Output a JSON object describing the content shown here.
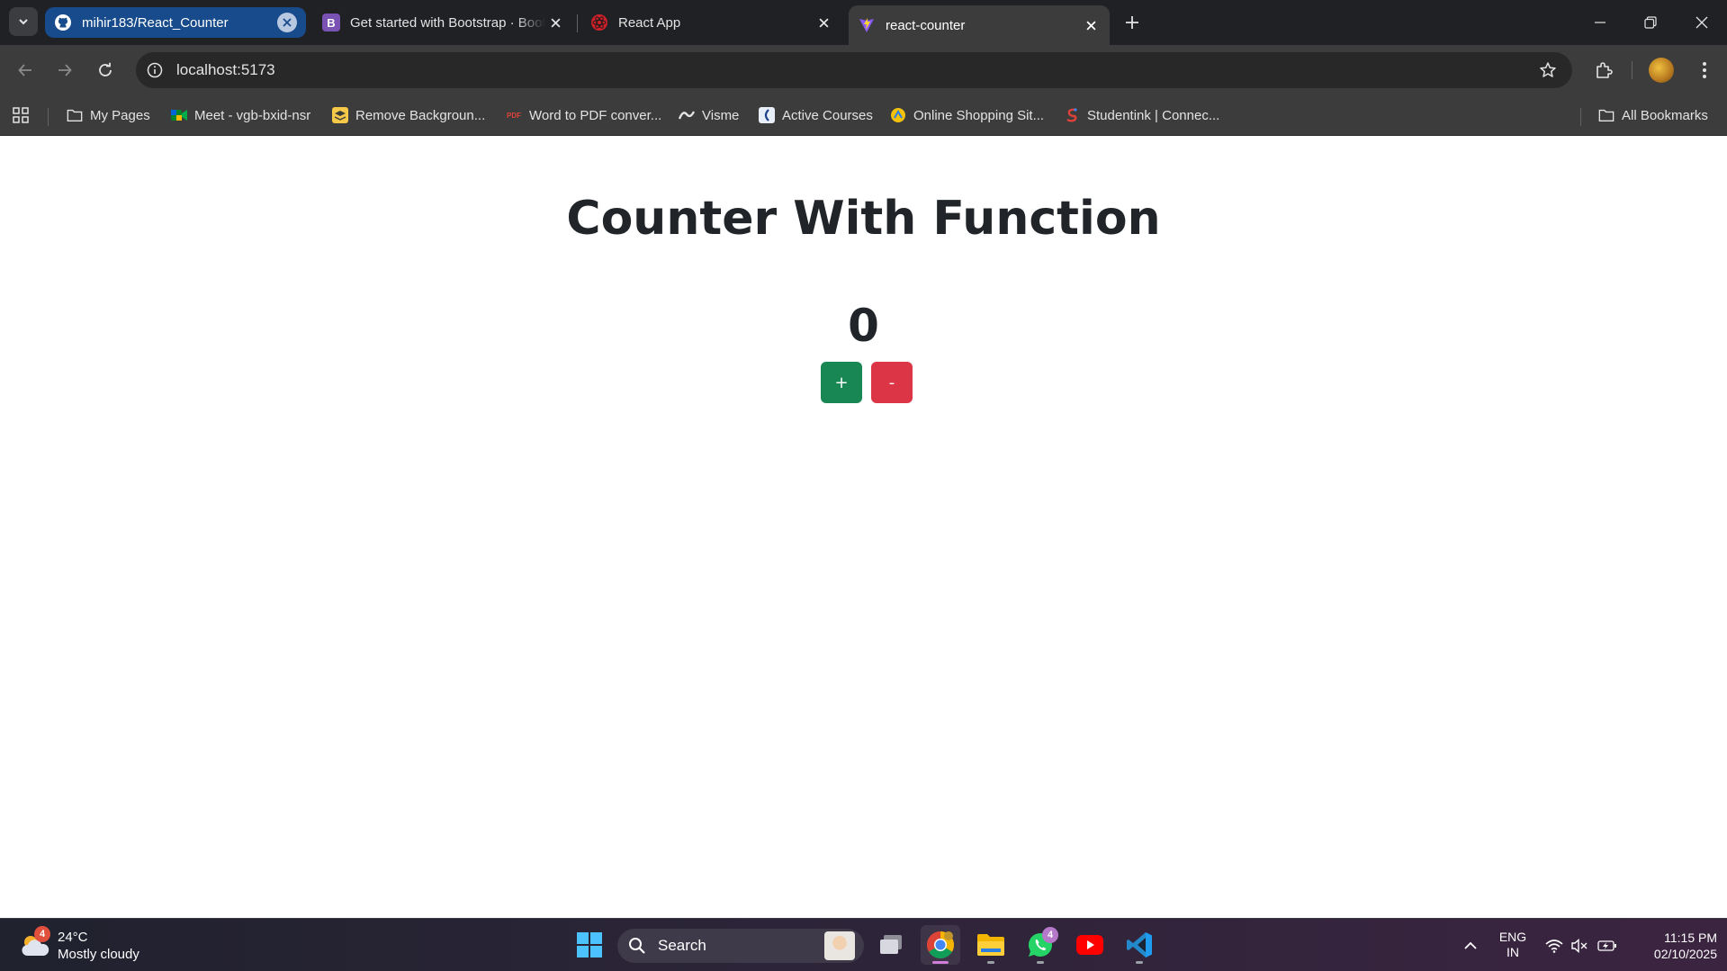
{
  "browser": {
    "tabs": [
      {
        "title": "mihir183/React_Counter",
        "favicon": "github-icon"
      },
      {
        "title": "Get started with Bootstrap · Bootstrap",
        "favicon": "bootstrap-icon"
      },
      {
        "title": "React App",
        "favicon": "react-icon"
      },
      {
        "title": "react-counter",
        "favicon": "vite-icon"
      }
    ],
    "url": "localhost:5173"
  },
  "bookmarks": [
    {
      "label": "My Pages",
      "icon": "folder-icon"
    },
    {
      "label": "Meet - vgb-bxid-nsr",
      "icon": "google-meet-icon"
    },
    {
      "label": "Remove Backgroun...",
      "icon": "remove-bg-icon"
    },
    {
      "label": "Word to PDF conver...",
      "icon": "pdf-icon"
    },
    {
      "label": "Visme",
      "icon": "visme-icon"
    },
    {
      "label": "Active Courses",
      "icon": "courses-icon"
    },
    {
      "label": "Online Shopping Sit...",
      "icon": "shopping-icon"
    },
    {
      "label": "Studentink | Connec...",
      "icon": "studentink-icon"
    }
  ],
  "all_bookmarks_label": "All Bookmarks",
  "app": {
    "heading": "Counter With Function",
    "count": "0",
    "increment_label": "+",
    "decrement_label": "-",
    "colors": {
      "increment": "#198754",
      "decrement": "#dc3545"
    }
  },
  "taskbar": {
    "weather": {
      "badge": "4",
      "temp": "24°C",
      "desc": "Mostly cloudy"
    },
    "search_label": "Search",
    "whatsapp_badge": "4",
    "lang_line1": "ENG",
    "lang_line2": "IN",
    "time": "11:15 PM",
    "date": "02/10/2025"
  }
}
